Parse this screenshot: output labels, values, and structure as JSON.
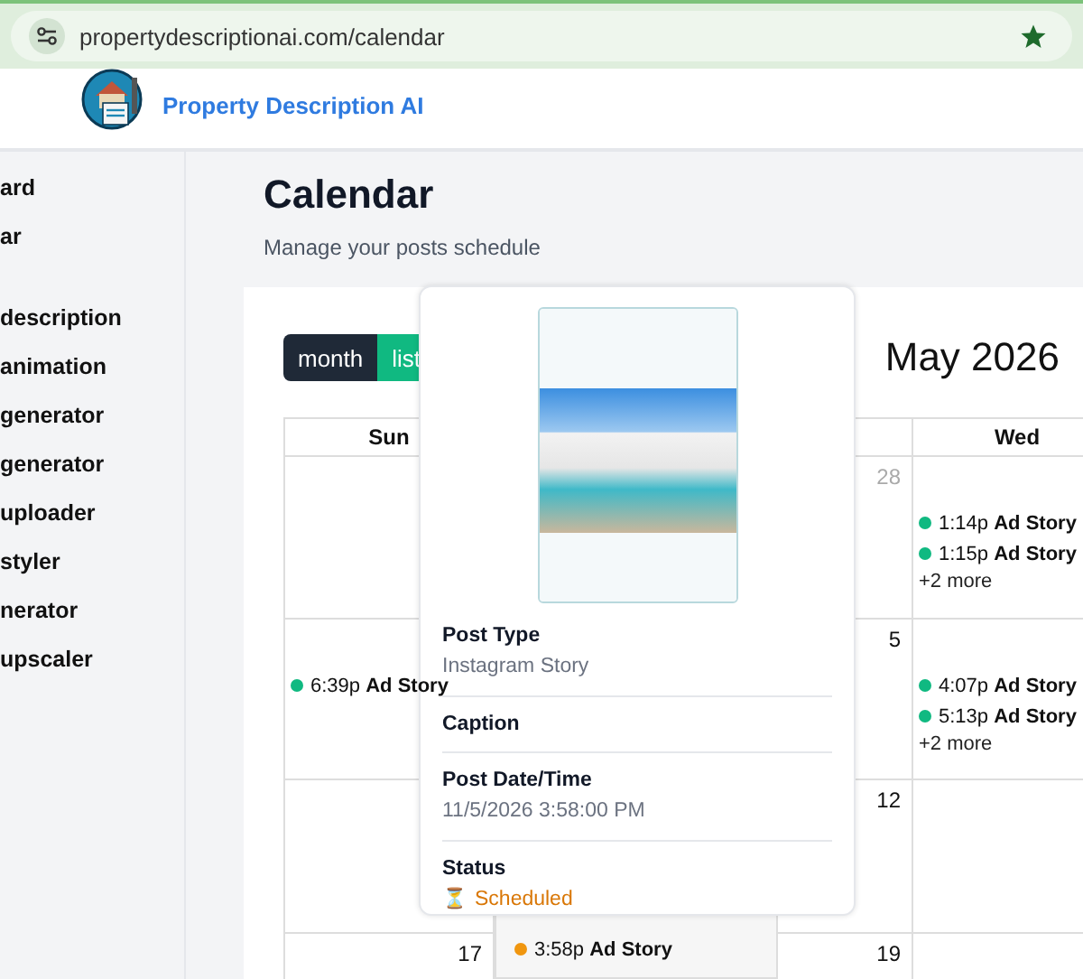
{
  "browser": {
    "url": "propertydescriptionai.com/calendar"
  },
  "header": {
    "app_name": "Property Description AI"
  },
  "sidebar": {
    "sections": [
      {
        "items": [
          "ard",
          "ar"
        ]
      },
      {
        "items": [
          "description",
          "animation",
          "generator",
          "generator",
          "uploader",
          "styler",
          "nerator",
          "upscaler"
        ]
      }
    ]
  },
  "page": {
    "title": "Calendar",
    "subtitle": "Manage your posts schedule"
  },
  "calendar": {
    "view_buttons": [
      {
        "label": "month",
        "selected": true
      },
      {
        "label": "list",
        "selected": false
      }
    ],
    "title": "May 2026",
    "weekdays": [
      {
        "label": "Sun"
      },
      {
        "label": "Wed"
      }
    ],
    "weeks": [
      {
        "cells": [
          {},
          {},
          {
            "day": "28",
            "other_month": true
          },
          {
            "events": [
              {
                "time": "1:14p",
                "title": "Ad Story",
                "color": "#10b981"
              },
              {
                "time": "1:15p",
                "title": "Ad Story",
                "color": "#10b981"
              }
            ],
            "more": "+2 more"
          }
        ]
      },
      {
        "cells": [
          {
            "events": [
              {
                "time": "6:39p",
                "title": "Ad Story",
                "color": "#10b981"
              }
            ]
          },
          {},
          {
            "day": "5",
            "other_month": false
          },
          {
            "events": [
              {
                "time": "4:07p",
                "title": "Ad Story",
                "color": "#10b981"
              },
              {
                "time": "5:13p",
                "title": "Ad Story",
                "color": "#10b981"
              }
            ],
            "more": "+2 more"
          }
        ]
      },
      {
        "cells": [
          {},
          {},
          {
            "day": "12",
            "other_month": false
          },
          {}
        ]
      },
      {
        "cells": [
          {
            "day": "17",
            "other_month": false
          },
          {},
          {
            "day": "19",
            "other_month": false
          },
          {}
        ]
      }
    ],
    "day_popup": {
      "events": [
        {
          "time": "3:58p",
          "title": "Ad Story",
          "color": "#f0960f"
        }
      ]
    }
  },
  "post_popover": {
    "fields": [
      {
        "kind": "text",
        "label": "Post Type",
        "value": "Instagram Story"
      },
      {
        "kind": "text",
        "label": "Caption"
      },
      {
        "kind": "text",
        "label": "Post Date/Time",
        "value": "11/5/2026 3:58:00 PM"
      },
      {
        "kind": "status",
        "label": "Status",
        "icon": "⏳",
        "value": "Scheduled"
      }
    ]
  }
}
